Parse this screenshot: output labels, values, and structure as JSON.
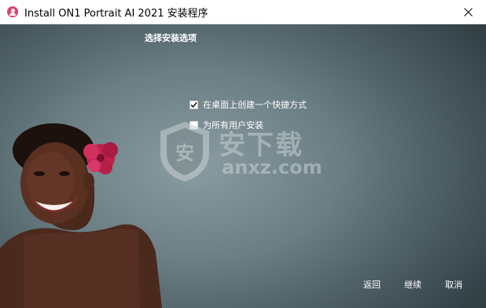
{
  "window": {
    "title": "Install ON1 Portrait AI 2021 安装程序",
    "app_icon": "person-icon",
    "close_icon": "close-icon"
  },
  "main": {
    "section_title": "选择安装选项",
    "options": [
      {
        "label": "在桌面上创建一个快捷方式",
        "checked": true
      },
      {
        "label": "为所有用户安装",
        "checked": false
      }
    ]
  },
  "watermark": {
    "cn": "安下载",
    "en": "anxz.com",
    "shield_glyph": "安"
  },
  "buttons": {
    "back": "返回",
    "continue": "继续",
    "cancel": "取消"
  },
  "colors": {
    "background_center": "#8a9ca0",
    "background_edge": "#2f3c41",
    "text": "#ffffff",
    "flower": "#c0224e"
  }
}
